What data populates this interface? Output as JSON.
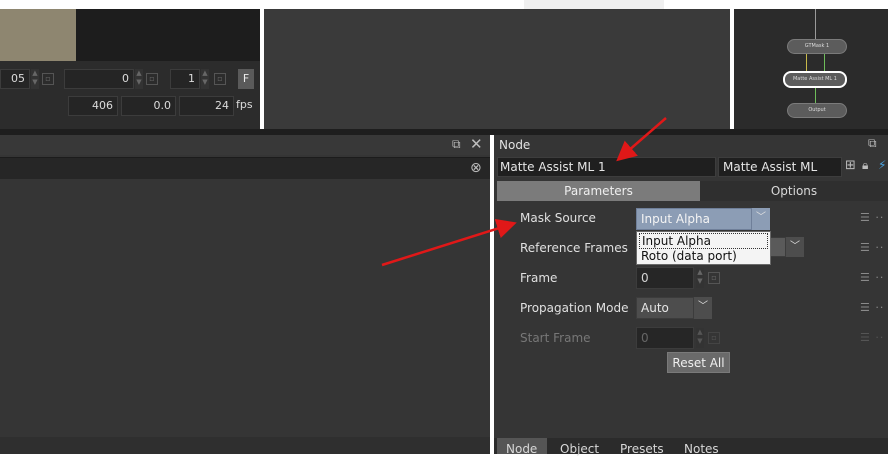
{
  "viewer": {
    "frame_partial": "05",
    "field_zero": "0",
    "field_one": "1",
    "f_label": "F",
    "frame_count": "406",
    "offset": "0.0",
    "fps_value": "24",
    "fps_label": "fps"
  },
  "node_graph": {
    "nodes": [
      "GTMask 1",
      "Matte Assist ML 1",
      "Output"
    ]
  },
  "node_panel": {
    "title": "Node",
    "name_value": "Matte Assist ML 1",
    "type_value": "Matte Assist ML",
    "tabs": [
      "Parameters",
      "Options"
    ],
    "params": {
      "mask_source_label": "Mask Source",
      "mask_source_value": "Input Alpha",
      "reference_frames_label": "Reference Frames",
      "frame_label": "Frame",
      "frame_value": "0",
      "propagation_label": "Propagation Mode",
      "propagation_value": "Auto",
      "start_frame_label": "Start Frame",
      "start_frame_value": "0"
    },
    "dropdown_options": [
      "Input Alpha",
      "Roto (data port)"
    ],
    "reset_label": "Reset All",
    "bottom_tabs": [
      "Node",
      "Object",
      "Presets",
      "Notes"
    ]
  },
  "colors": {
    "annotation_arrow": "#e01818",
    "panel_bg": "#353535",
    "tab_active": "#7b7b7b"
  }
}
